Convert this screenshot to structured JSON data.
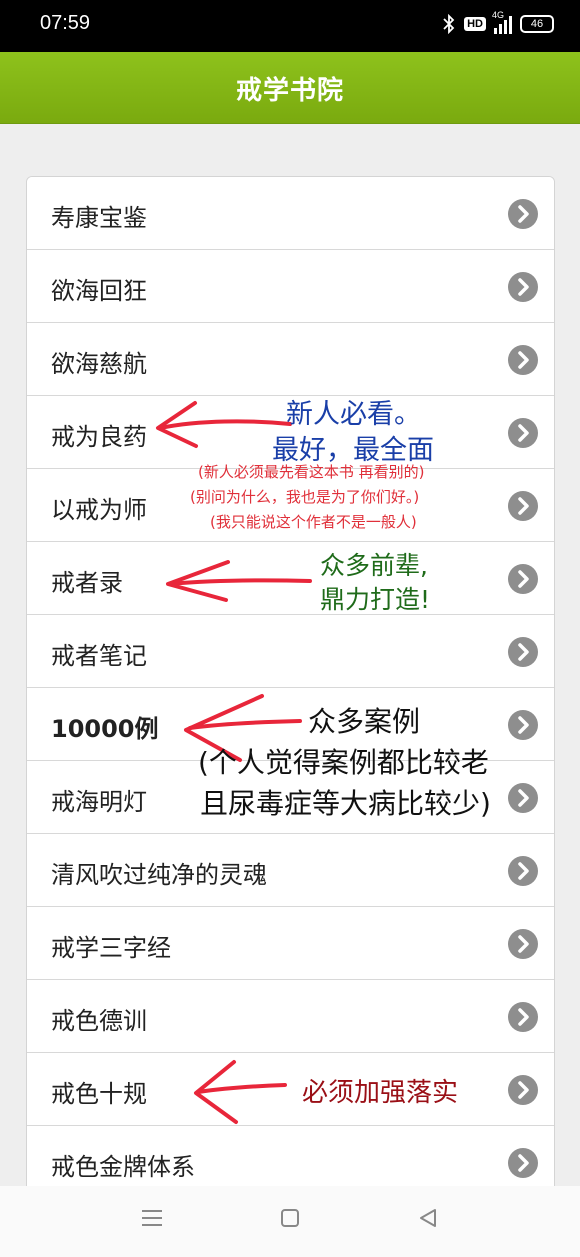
{
  "status_bar": {
    "time": "07:59",
    "hd_badge": "HD",
    "network": "4G",
    "battery": "46"
  },
  "app_bar": {
    "title": "戒学书院"
  },
  "items": [
    {
      "label": "寿康宝鉴"
    },
    {
      "label": "欲海回狂"
    },
    {
      "label": "欲海慈航"
    },
    {
      "label": "戒为良药"
    },
    {
      "label": "以戒为师"
    },
    {
      "label": "戒者录"
    },
    {
      "label": "戒者笔记"
    },
    {
      "label": "10000例"
    },
    {
      "label": "戒海明灯"
    },
    {
      "label": "清风吹过纯净的灵魂"
    },
    {
      "label": "戒学三字经"
    },
    {
      "label": "戒色德训"
    },
    {
      "label": "戒色十规"
    },
    {
      "label": "戒色金牌体系"
    }
  ],
  "annotations": {
    "a1_line1": "新人必看。",
    "a1_line2": "最好，最全面",
    "a1_note1": "(新人必须最先看这本书 再看别的)",
    "a1_note2": "(别问为什么，我也是为了你们好。)",
    "a1_note3": "(我只能说这个作者不是一般人)",
    "a2_line1": "众多前辈,",
    "a2_line2": "鼎力打造!",
    "a3_line1": "众多案例",
    "a3_line2": "(个人觉得案例都比较老",
    "a3_line3": "且尿毒症等大病比较少)",
    "a4_line1": "必须加强落实"
  },
  "colors": {
    "app_bar": "#86b817",
    "annotation_blue": "#1a3fa8",
    "annotation_red": "#e0303a",
    "annotation_green": "#1f6b1a",
    "annotation_black": "#111111",
    "annotation_darkred": "#9a0f16",
    "arrow": "#e8263a"
  },
  "icons": [
    "bluetooth-icon",
    "signal-icon",
    "battery-icon",
    "chevron-right-icon",
    "menu-icon",
    "home-icon",
    "back-icon"
  ]
}
